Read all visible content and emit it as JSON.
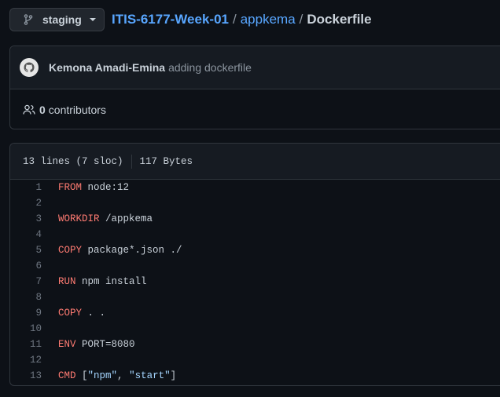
{
  "branch": {
    "label": "staging"
  },
  "breadcrumb": {
    "repo": "ITIS-6177-Week-01",
    "sep1": "/",
    "dir": "appkema",
    "sep2": "/",
    "file": "Dockerfile"
  },
  "commit": {
    "author": "Kemona Amadi-Emina",
    "message": "adding dockerfile"
  },
  "contributors": {
    "count": "0",
    "label": "contributors"
  },
  "file_info": {
    "lines": "13 lines (7 sloc)",
    "size": "117 Bytes"
  },
  "code_lines": [
    {
      "n": "1",
      "kw": "FROM",
      "rest": " node:12"
    },
    {
      "n": "2",
      "kw": "",
      "rest": ""
    },
    {
      "n": "3",
      "kw": "WORKDIR",
      "rest": " /appkema"
    },
    {
      "n": "4",
      "kw": "",
      "rest": ""
    },
    {
      "n": "5",
      "kw": "COPY",
      "rest": " package*.json ./"
    },
    {
      "n": "6",
      "kw": "",
      "rest": ""
    },
    {
      "n": "7",
      "kw": "RUN",
      "rest": " npm install"
    },
    {
      "n": "8",
      "kw": "",
      "rest": ""
    },
    {
      "n": "9",
      "kw": "COPY",
      "rest": " . ."
    },
    {
      "n": "10",
      "kw": "",
      "rest": ""
    },
    {
      "n": "11",
      "kw": "ENV",
      "rest": " PORT=8080"
    },
    {
      "n": "12",
      "kw": "",
      "rest": ""
    },
    {
      "n": "13",
      "kw": "CMD",
      "rest": " [",
      "s1": "\"npm\"",
      "mid": ", ",
      "s2": "\"start\"",
      "end": "]"
    }
  ],
  "colors": {
    "background": "#0d1117",
    "link": "#58a6ff",
    "keyword": "#ff7b72",
    "string": "#a5d6ff"
  }
}
